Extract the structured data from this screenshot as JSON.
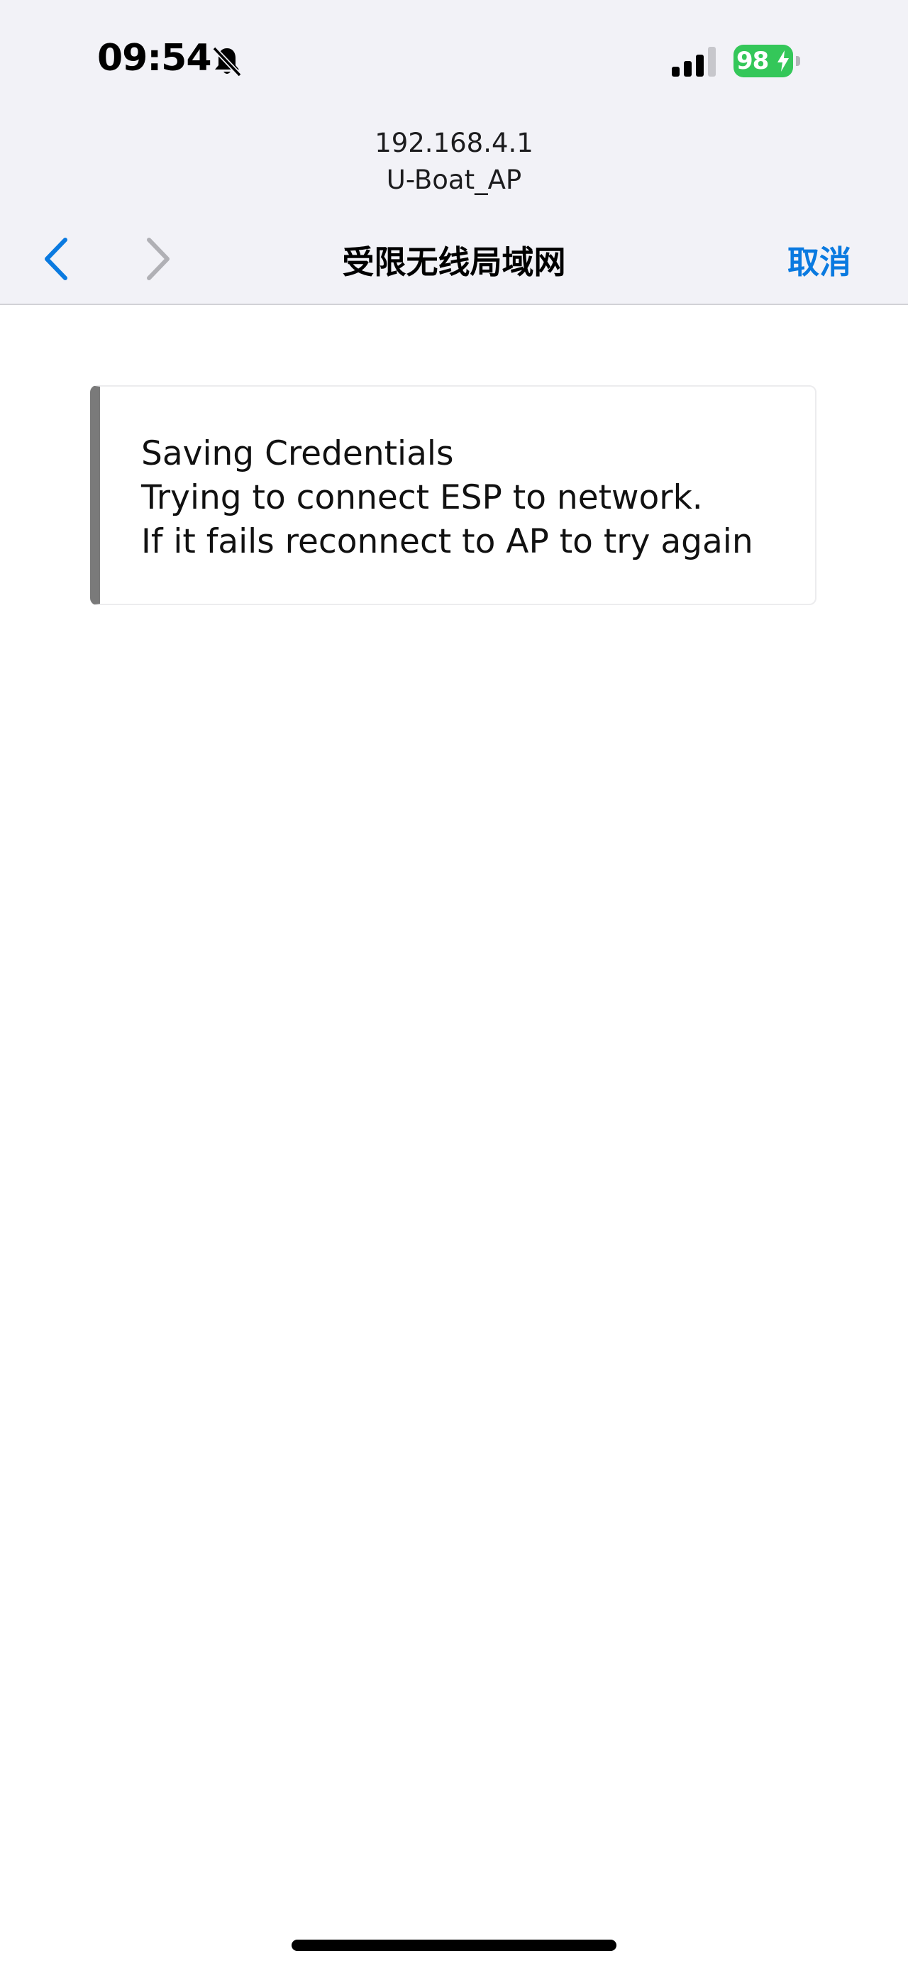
{
  "status_bar": {
    "time": "09:54",
    "battery_level": "98",
    "icons": [
      "bell-slash-icon",
      "signal-icon",
      "battery-icon",
      "charging-bolt-icon"
    ]
  },
  "address": {
    "host": "192.168.4.1",
    "ssid": "U-Boat_AP"
  },
  "nav": {
    "title": "受限无线局域网",
    "cancel_label": "取消",
    "back_enabled": true,
    "forward_enabled": false
  },
  "message": {
    "lines": [
      "Saving Credentials",
      "Trying to connect ESP to network.",
      "If it fails reconnect to AP to try again"
    ]
  },
  "colors": {
    "accent": "#0a7ae0",
    "battery": "#34c759",
    "card_border": "#7a7a7a",
    "topbar_bg": "#f2f2f7"
  }
}
